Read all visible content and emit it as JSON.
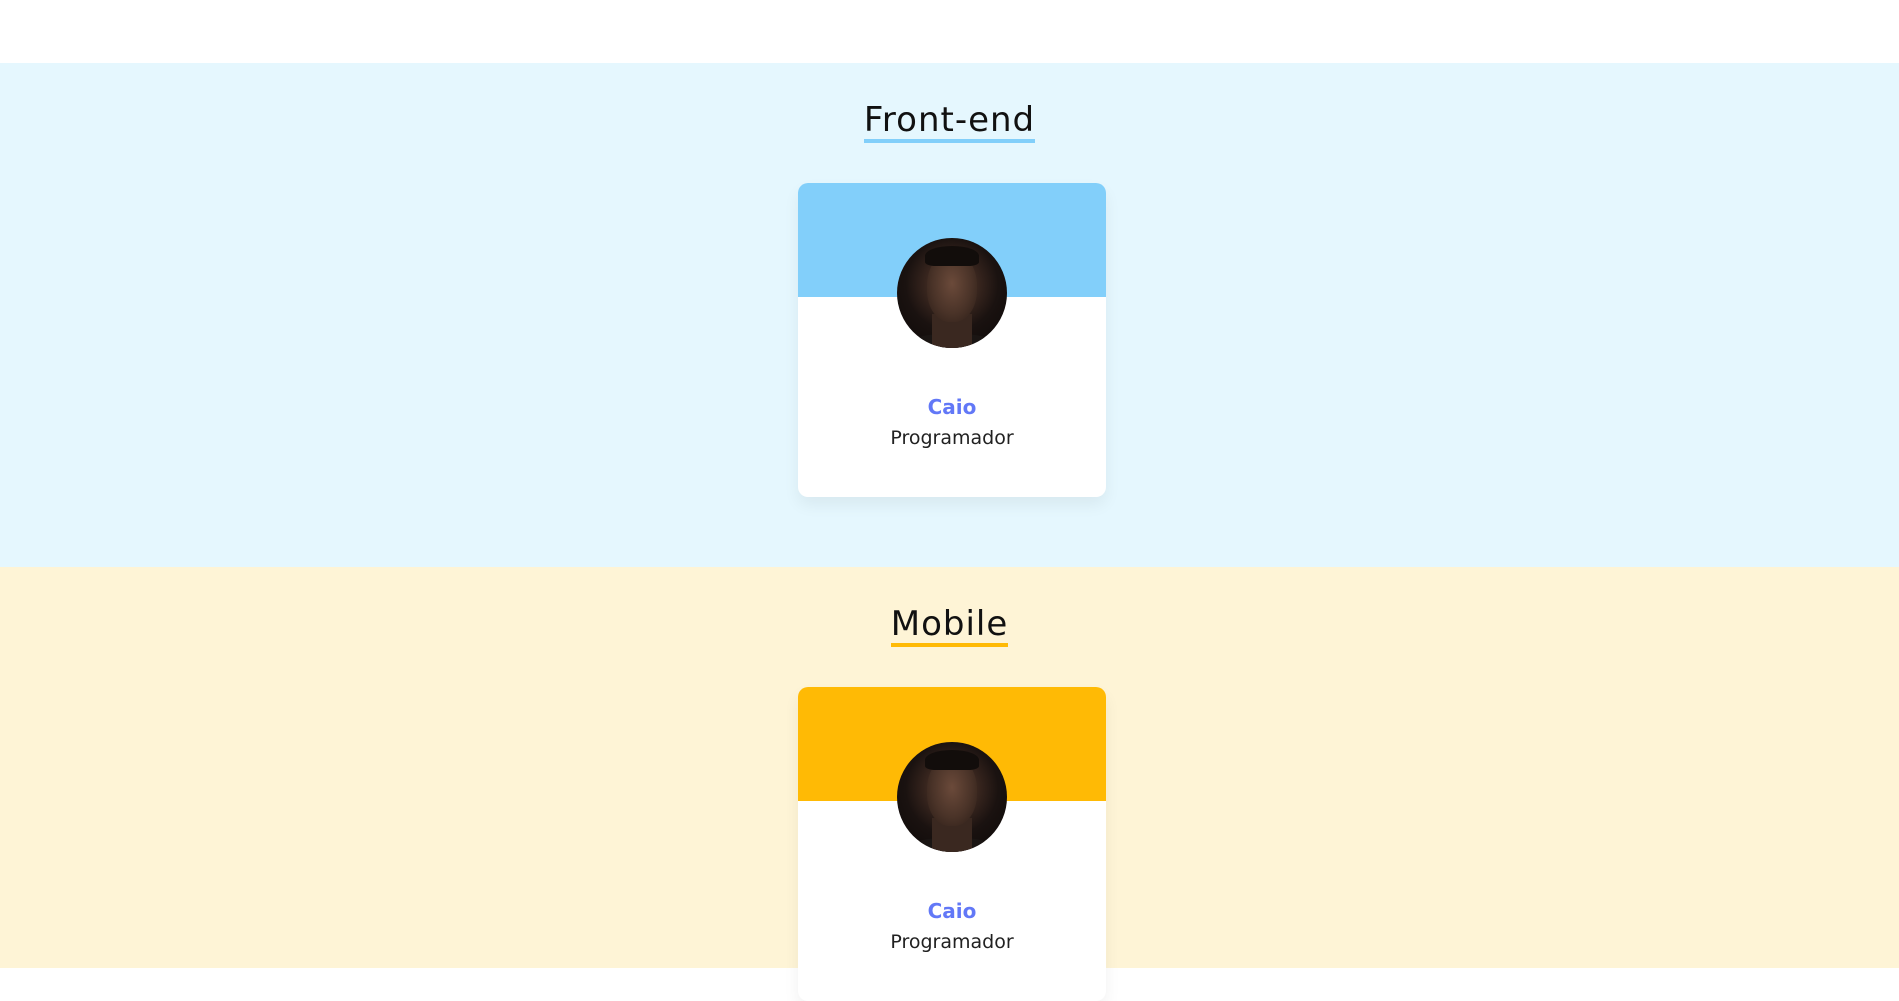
{
  "colors": {
    "page_background": "#ffffff",
    "frontend_background": "#e5f7fe",
    "frontend_accent": "#82cffa",
    "mobile_background": "#fef4d6",
    "mobile_accent": "#ffba05",
    "name_color": "#6278f7",
    "role_color": "#212121"
  },
  "sections": [
    {
      "title": "Front-end",
      "members": [
        {
          "name": "Caio",
          "role": "Programador",
          "avatar": "profile-photo"
        }
      ]
    },
    {
      "title": "Mobile",
      "members": [
        {
          "name": "Caio",
          "role": "Programador",
          "avatar": "profile-photo"
        }
      ]
    }
  ]
}
